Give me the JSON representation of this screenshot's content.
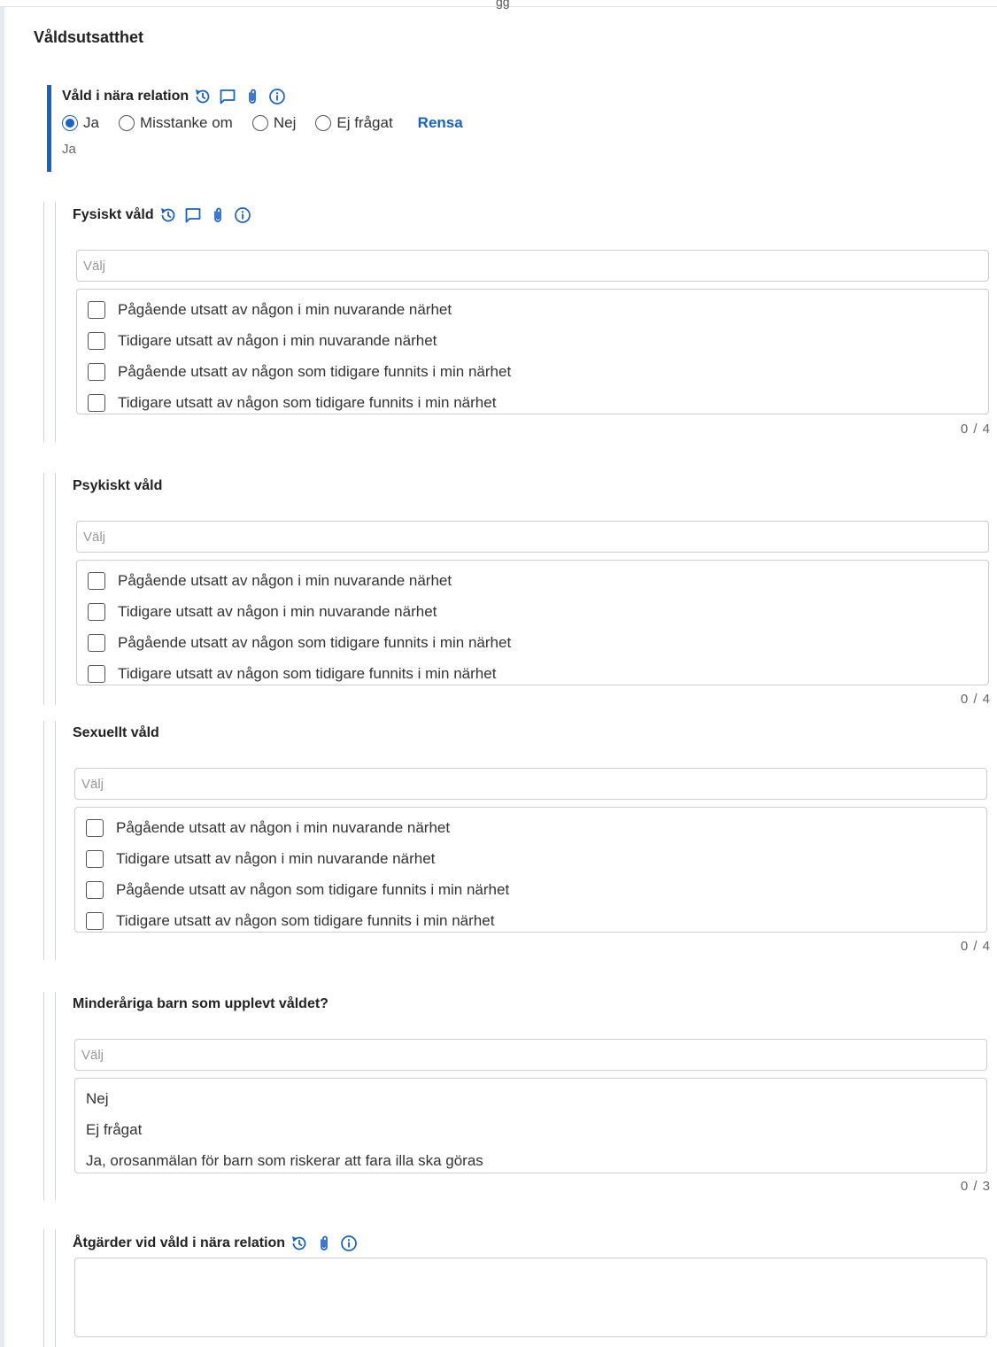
{
  "header": {
    "glyph": "gg",
    "section_title": "Våldsutsatthet"
  },
  "main_question": {
    "label": "Våld i nära relation",
    "options": [
      "Ja",
      "Misstanke om",
      "Nej",
      "Ej frågat"
    ],
    "selected": "Ja",
    "clear_label": "Rensa",
    "current_value": "Ja"
  },
  "groups": [
    {
      "label": "Fysiskt våld",
      "placeholder": "Välj",
      "options": [
        "Pågående utsatt av någon i min nuvarande närhet",
        "Tidigare utsatt av någon i min nuvarande närhet",
        "Pågående utsatt av någon som tidigare funnits i min närhet",
        "Tidigare utsatt av någon som tidigare funnits i min närhet"
      ],
      "counter": "0 / 4"
    },
    {
      "label": "Psykiskt våld",
      "placeholder": "Välj",
      "options": [
        "Pågående utsatt av någon i min nuvarande närhet",
        "Tidigare utsatt av någon i min nuvarande närhet",
        "Pågående utsatt av någon som tidigare funnits i min närhet",
        "Tidigare utsatt av någon som tidigare funnits i min närhet"
      ],
      "counter": "0 / 4"
    },
    {
      "label": "Sexuellt våld",
      "placeholder": "Välj",
      "options": [
        "Pågående utsatt av någon i min nuvarande närhet",
        "Tidigare utsatt av någon i min nuvarande närhet",
        "Pågående utsatt av någon som tidigare funnits i min närhet",
        "Tidigare utsatt av någon som tidigare funnits i min närhet"
      ],
      "counter": "0 / 4"
    },
    {
      "label": "Minderåriga barn som upplevt våldet?",
      "placeholder": "Välj",
      "options": [
        "Nej",
        "Ej frågat",
        "Ja, orosanmälan för barn som riskerar att fara illa ska göras"
      ],
      "counter": "0 / 3"
    },
    {
      "label": "Åtgärder vid våld i nära relation",
      "text_value": ""
    }
  ],
  "colors": {
    "accent": "#1a62c2",
    "border": "#c9cdd2",
    "guide": "#cfd4da"
  }
}
